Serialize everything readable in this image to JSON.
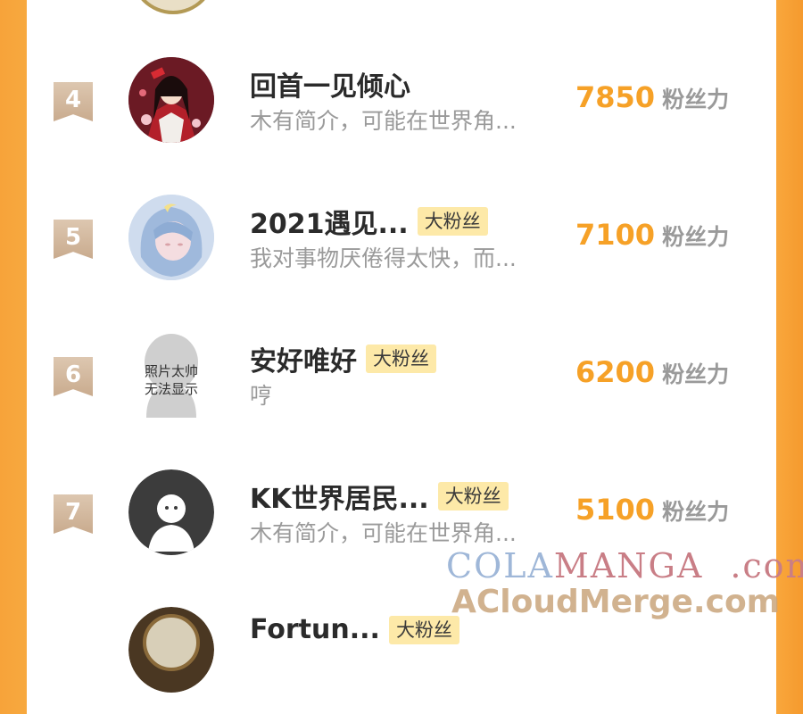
{
  "rows": [
    {
      "rank": "4",
      "name": "回首一见倾心",
      "badge": "",
      "bio": "木有简介，可能在世界角...",
      "score": "7850",
      "unit": "粉丝力",
      "avatar_icon": "anime-girl-avatar"
    },
    {
      "rank": "5",
      "name": "2021遇见...",
      "badge": "大粉丝",
      "bio": "我对事物厌倦得太快，而...",
      "score": "7100",
      "unit": "粉丝力",
      "avatar_icon": "blue-hair-avatar"
    },
    {
      "rank": "6",
      "name": "安好唯好",
      "badge": "大粉丝",
      "bio": "哼",
      "score": "6200",
      "unit": "粉丝力",
      "avatar_icon": "placeholder-avatar",
      "avatar_text": [
        "照片太帅",
        "无法显示"
      ]
    },
    {
      "rank": "7",
      "name": "KK世界居民...",
      "badge": "大粉丝",
      "bio": "木有简介，可能在世界角...",
      "score": "5100",
      "unit": "粉丝力",
      "avatar_icon": "default-ghost-avatar"
    },
    {
      "rank": "",
      "name": "Fortun...",
      "badge": "大粉丝",
      "bio": "",
      "score": "",
      "unit": "",
      "avatar_icon": "clock-avatar"
    }
  ],
  "watermark": {
    "line1_a": "COLA",
    "line1_b": "MANGA",
    "line1_c": ".com",
    "line2": "ACloudMerge.com"
  },
  "colors": {
    "accent": "#f6a127",
    "badge_bg": "#fde9a8",
    "side_orange": "#f7a33a"
  }
}
